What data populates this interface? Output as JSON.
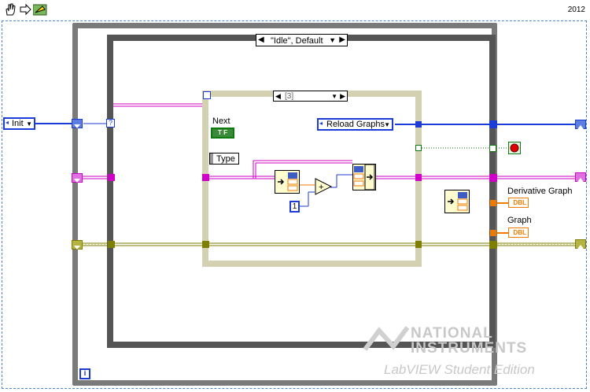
{
  "toolbar": {
    "version": "2012"
  },
  "case_structure": {
    "selector": "\"Idle\", Default"
  },
  "sequence_structure": {
    "selector": "[3]"
  },
  "controls": {
    "init_enum": "Init",
    "reload_enum": "Reload Graphs",
    "numeric_constant": "1",
    "question": "?"
  },
  "labels": {
    "next": "Next",
    "next_bool": "T F",
    "type": "Type",
    "derivative_graph": "Derivative Graph",
    "graph": "Graph",
    "dbl": "DBL",
    "iteration": "i"
  },
  "watermark": {
    "line1": "NATIONAL",
    "line2": "INSTRUMENTS",
    "line3": "LabVIEW Student Edition"
  },
  "colors": {
    "enum_wire": "#1d3bd6",
    "cluster_wire": "#d000c8",
    "error_wire": "#7e7e00",
    "boolean_wire": "#0e7a0e",
    "dbl_wire": "#f07a00"
  }
}
